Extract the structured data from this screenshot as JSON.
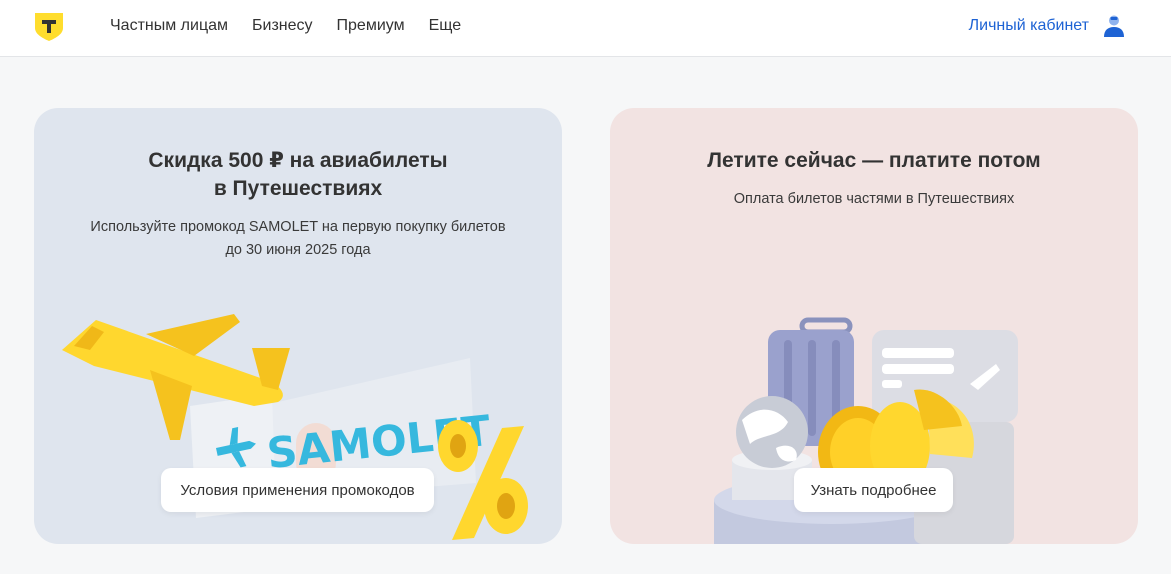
{
  "header": {
    "logo": "T",
    "nav": [
      "Частным лицам",
      "Бизнесу",
      "Премиум",
      "Еще"
    ],
    "cabinet_label": "Личный кабинет",
    "icons": {
      "logo": "shield-logo-icon",
      "user": "user-icon"
    },
    "colors": {
      "logo_yellow": "#ffdd2d",
      "link_blue": "#1e63d4"
    }
  },
  "cards": [
    {
      "title_line1": "Скидка 500 ₽ на авиабилеты",
      "title_line2": "в Путешествиях",
      "subtitle_line1": "Используйте промокод SAMOLET на первую покупку билетов",
      "subtitle_line2": "до 30 июня 2025 года",
      "art_text": "SAMOLET",
      "button": "Условия применения промокодов",
      "background": "#dfe5ee"
    },
    {
      "title": "Летите сейчас — платите потом",
      "subtitle": "Оплата билетов частями в Путешествиях",
      "button": "Узнать подробнее",
      "background": "#f2e3e2"
    }
  ]
}
